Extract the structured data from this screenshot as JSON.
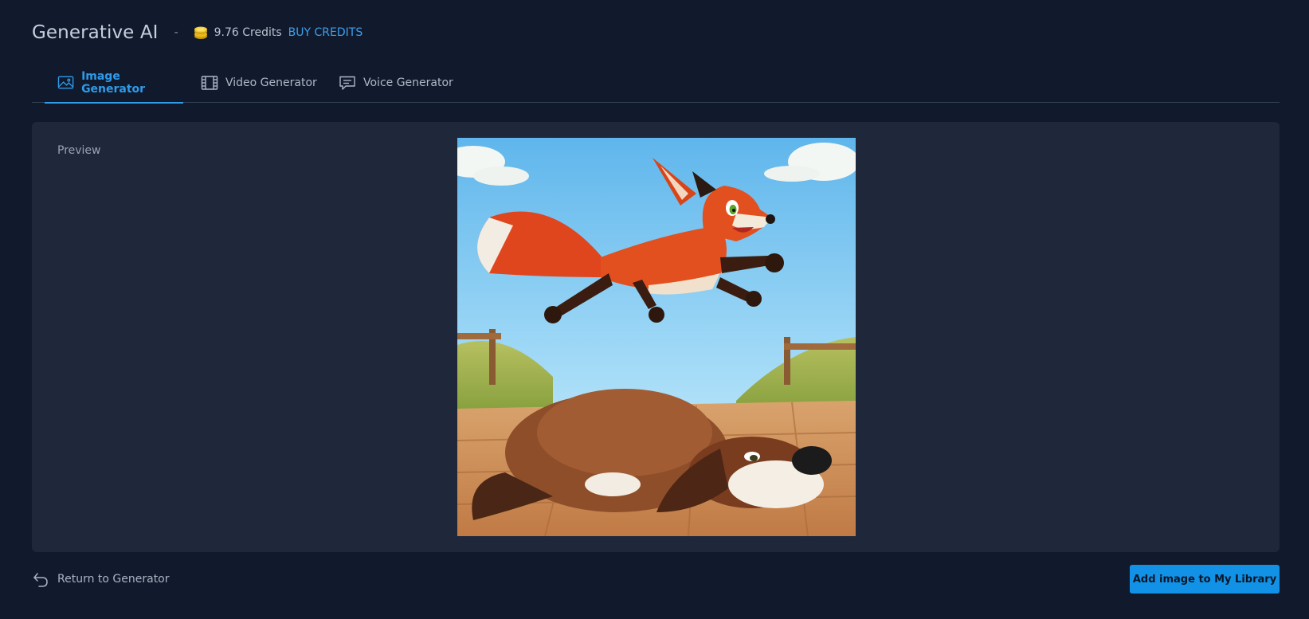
{
  "header": {
    "title": "Generative AI",
    "separator": "-",
    "credits": "9.76 Credits",
    "buy_credits": "BUY CREDITS"
  },
  "tabs": [
    {
      "label": "Image Generator",
      "icon": "image-icon",
      "active": true
    },
    {
      "label": "Video Generator",
      "icon": "film-icon",
      "active": false
    },
    {
      "label": "Voice Generator",
      "icon": "speech-bubble-icon",
      "active": false
    }
  ],
  "preview": {
    "label": "Preview"
  },
  "footer": {
    "return_label": "Return to Generator",
    "add_label": "Add image to My Library"
  },
  "colors": {
    "background": "#111a2d",
    "panel": "#1e283a",
    "accent": "#2f9bea",
    "button": "#1292e6"
  }
}
